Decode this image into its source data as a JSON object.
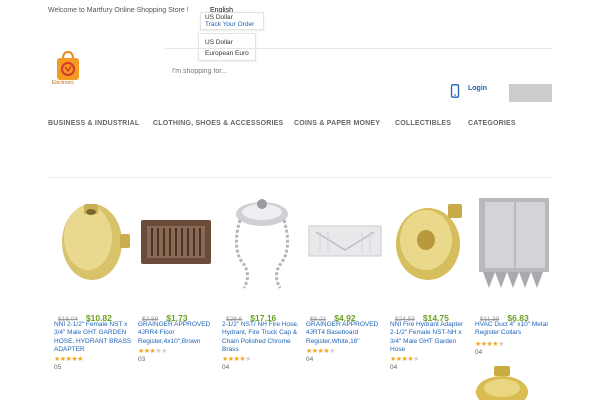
{
  "topbar": {
    "welcome": "Welcome to Martfury Online Shopping Store !",
    "language": "English",
    "currency_current": "US Dollar",
    "track_order": "Track Your Order",
    "currency_options": [
      "US Dollar",
      "European Euro"
    ]
  },
  "logo": {
    "text": "Electronic"
  },
  "search": {
    "placeholder": "I'm shopping for..."
  },
  "header": {
    "login": "Login"
  },
  "nav": {
    "items": [
      "BUSINESS & INDUSTRIAL",
      "CLOTHING, SHOES & ACCESSORIES",
      "COINS & PAPER MONEY",
      "COLLECTIBLES",
      "CATEGORIES"
    ]
  },
  "products": [
    {
      "old_price": "$18.04",
      "price": "$10.82",
      "name": "NNI 2-1/2\" Female NST x 3/4\" Male GHT GARDEN HOSE, HYDRANT BRASS ADAPTER",
      "rating": 5,
      "reviews": "05"
    },
    {
      "old_price": "$2.89",
      "price": "$1.73",
      "name": "GRAINGER APPROVED 4JRR4 Floor Register,4x10\",Brown",
      "rating": 3,
      "reviews": "03"
    },
    {
      "old_price": "$28.6",
      "price": "$17.16",
      "name": "2-1/2\" NST/ NH Fire Hose, Hydrant, Fire Truck Cap & Chain Polished Chrome Brass",
      "rating": 4,
      "reviews": "04"
    },
    {
      "old_price": "$8.21",
      "price": "$4.92",
      "name": "GRAINGER APPROVED 4JRT4 Baseboard Register,White,18\"",
      "rating": 4,
      "reviews": "04"
    },
    {
      "old_price": "$24.59",
      "price": "$14.75",
      "name": "NNI Fire Hydrant Adapter 2-1/2\" Female NST-NH x 3/4\" Male GHT Garden Hose",
      "rating": 4,
      "reviews": "04"
    },
    {
      "old_price": "$11.39",
      "price": "$6.83",
      "name": "HVAC Duct 4\" x10\" Metal Register Collars",
      "rating": 4,
      "reviews": "04"
    }
  ],
  "colors": {
    "link": "#1e63b8",
    "price": "#6aa11e",
    "star": "#f5a623"
  }
}
